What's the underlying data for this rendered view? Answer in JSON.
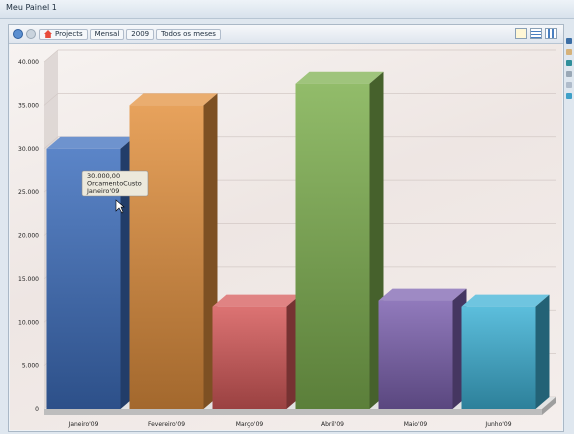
{
  "window": {
    "title": "Meu Painel 1"
  },
  "breadcrumb": [
    "Projects",
    "Mensal",
    "2009",
    "Todos os meses"
  ],
  "chart_data": {
    "type": "bar",
    "categories": [
      "Janeiro'09",
      "Fevereiro'09",
      "Março'09",
      "Abril'09",
      "Maio'09",
      "Junho'09"
    ],
    "values": [
      30000,
      35000,
      11800,
      37500,
      12500,
      11800
    ],
    "colors": [
      "#3e6fbe",
      "#e3913f",
      "#d65a5a",
      "#7fb050",
      "#7d63b0",
      "#3fb2d6"
    ],
    "y_ticks": [
      "0",
      "5.000",
      "10.000",
      "15.000",
      "20.000",
      "25.000",
      "30.000",
      "35.000",
      "40.000"
    ],
    "ylim": [
      0,
      40000
    ],
    "grid": true
  },
  "tooltip": {
    "value": "30.000,00",
    "series": "OrcamentoCusto",
    "category": "Janeiro'09"
  }
}
